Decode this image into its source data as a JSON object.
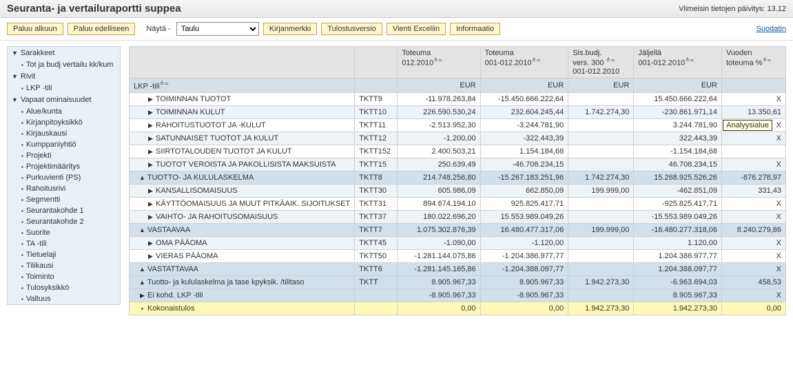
{
  "header": {
    "title": "Seuranta- ja vertailuraportti suppea",
    "updated": "Viimeisin tietojen päivitys: 13.12"
  },
  "toolbar": {
    "back_start": "Paluu alkuun",
    "back_prev": "Paluu edelliseen",
    "nayta_label": "Näytä -",
    "nayta_value": "Taulu",
    "bookmark": "Kirjanmerkki",
    "print": "Tulostusversio",
    "excel": "Vienti Exceliin",
    "info": "Informaatio",
    "filter": "Suodatin"
  },
  "sidebar": {
    "groups": [
      {
        "title": "Sarakkeet",
        "items": [
          "Tot ja budj vertailu kk/kum"
        ]
      },
      {
        "title": "Rivit",
        "items": [
          "LKP -tili"
        ]
      },
      {
        "title": "Vapaat ominaisuudet",
        "items": [
          "Alue/kunta",
          "Kirjanpitoyksikkö",
          "Kirjauskausi",
          "Kumppaniyhtiö",
          "Projekti",
          "Projektimääritys",
          "Purkuvienti (PS)",
          "Rahoitusrivi",
          "Segmentti",
          "Seurantakohde 1",
          "Seurantakohde 2",
          "Suorite",
          "TA -tili",
          "Tietuelaji",
          "Tilikausi",
          "Toiminto",
          "Tulosyksikkö",
          "Valtuus"
        ]
      }
    ]
  },
  "grid": {
    "col0": "",
    "col1": "",
    "col2": {
      "l1": "Toteuma",
      "l2": "012.2010"
    },
    "col3": {
      "l1": "Toteuma",
      "l2": "001-012.2010"
    },
    "col4": {
      "l1": "Sis.budj.",
      "l2": "vers. 300",
      "l3": "001-012.2010"
    },
    "col5": {
      "l1": "Jäljellä",
      "l2": "001-012.2010"
    },
    "col6": {
      "l1": "Vuoden",
      "l2": "toteuma %"
    },
    "h2_lkp": "LKP -tili",
    "h2_eur": "EUR",
    "rows": [
      {
        "cls": "odd",
        "exp": "▶",
        "ind": 1,
        "label": "TOIMINNAN TUOTOT",
        "code": "TKTT9",
        "c2": "-11.978.263,84",
        "c3": "-15.450.666.222,64",
        "c4": "",
        "c5": "15.450.666.222,64",
        "c6": "X"
      },
      {
        "cls": "even",
        "exp": "▶",
        "ind": 1,
        "label": "TOIMINNAN KULUT",
        "code": "TKTT10",
        "c2": "226.590.530,24",
        "c3": "232.604.245,44",
        "c4": "1.742.274,30",
        "c5": "-230.861.971,14",
        "c6": "13.350,61"
      },
      {
        "cls": "odd",
        "exp": "▶",
        "ind": 1,
        "label": "RAHOITUSTUOTOT JA -KULUT",
        "code": "TKTT11",
        "c2": "-2.513.952,30",
        "c3": "-3.244.781,90",
        "c4": "",
        "c5": "3.244.781,90",
        "c6": "X"
      },
      {
        "cls": "even",
        "exp": "▶",
        "ind": 1,
        "label": "SATUNNAISET TUOTOT JA KULUT",
        "code": "TKTT12",
        "c2": "-1.200,00",
        "c3": "-322.443,39",
        "c4": "",
        "c5": "322.443,39",
        "c6": "X"
      },
      {
        "cls": "odd",
        "exp": "▶",
        "ind": 1,
        "label": "SIIRTOTALOUDEN TUOTOT JA KULUT",
        "code": "TKTT152",
        "c2": "2.400.503,21",
        "c3": "1.154.184,68",
        "c4": "",
        "c5": "-1.154.184,68",
        "c6": ""
      },
      {
        "cls": "even",
        "exp": "▶",
        "ind": 1,
        "label": "TUOTOT VEROISTA JA PAKOLLISISTA MAKSUISTA",
        "code": "TKTT15",
        "c2": "250.639,49",
        "c3": "-46.708.234,15",
        "c4": "",
        "c5": "46.708.234,15",
        "c6": "X"
      },
      {
        "cls": "blue",
        "exp": "▲",
        "ind": 0,
        "label": "TUOTTO- JA KULULASKELMA",
        "code": "TKTT8",
        "c2": "214.748.256,80",
        "c3": "-15.267.183.251,96",
        "c4": "1.742.274,30",
        "c5": "15.268.925.526,26",
        "c6": "-876.278,97"
      },
      {
        "cls": "even",
        "exp": "▶",
        "ind": 1,
        "label": "KANSALLISOMAISUUS",
        "code": "TKTT30",
        "c2": "605.986,09",
        "c3": "662.850,09",
        "c4": "199.999,00",
        "c5": "-462.851,09",
        "c6": "331,43"
      },
      {
        "cls": "odd",
        "exp": "▶",
        "ind": 1,
        "label": "KÄYTTÖOMAISUUS JA MUUT PITKÄAIK. SIJOITUKSET",
        "code": "TKTT31",
        "c2": "894.674.194,10",
        "c3": "925.825.417,71",
        "c4": "",
        "c5": "-925.825.417,71",
        "c6": "X"
      },
      {
        "cls": "even",
        "exp": "▶",
        "ind": 1,
        "label": "VAIHTO- JA RAHOITUSOMAISUUS",
        "code": "TKTT37",
        "c2": "180.022.696,20",
        "c3": "15.553.989.049,26",
        "c4": "",
        "c5": "-15.553.989.049,26",
        "c6": "X"
      },
      {
        "cls": "blue",
        "exp": "▲",
        "ind": 0,
        "label": "VASTAAVAA",
        "code": "TKTT7",
        "c2": "1.075.302.876,39",
        "c3": "16.480.477.317,06",
        "c4": "199.999,00",
        "c5": "-16.480.277.318,06",
        "c6": "8.240.279,86"
      },
      {
        "cls": "even",
        "exp": "▶",
        "ind": 1,
        "label": "OMA PÄÄOMA",
        "code": "TKTT45",
        "c2": "-1.090,00",
        "c3": "-1.120,00",
        "c4": "",
        "c5": "1.120,00",
        "c6": "X"
      },
      {
        "cls": "odd",
        "exp": "▶",
        "ind": 1,
        "label": "VIERAS PÄÄOMA",
        "code": "TKTT50",
        "c2": "-1.281.144.075,86",
        "c3": "-1.204.386.977,77",
        "c4": "",
        "c5": "1.204.386.977,77",
        "c6": "X"
      },
      {
        "cls": "blue",
        "exp": "▲",
        "ind": 0,
        "label": "VASTATTAVAA",
        "code": "TKTT6",
        "c2": "-1.281.145.165,86",
        "c3": "-1.204.388.097,77",
        "c4": "",
        "c5": "1.204.388.097,77",
        "c6": "X"
      },
      {
        "cls": "blue",
        "exp": "▲",
        "ind": 0,
        "label": "Tuotto- ja kululaskelma ja tase kpyksik. /tilitaso",
        "code": "TKTT",
        "c2": "8.905.967,33",
        "c3": "8.905.967,33",
        "c4": "1.942.273,30",
        "c5": "-6.963.694,03",
        "c6": "458,53"
      },
      {
        "cls": "blue",
        "exp": "▶",
        "ind": 0,
        "label": "Ei kohd. LKP -tili",
        "code": "",
        "c2": "-8.905.967,33",
        "c3": "-8.905.967,33",
        "c4": "",
        "c5": "8.905.967,33",
        "c6": "X"
      },
      {
        "cls": "highlight",
        "exp": "▪",
        "ind": 0,
        "label": "Kokonaistulos",
        "code": "",
        "c2": "0,00",
        "c3": "0,00",
        "c4": "1.942.273,30",
        "c5": "1.942.273,30",
        "c6": "0,00"
      }
    ]
  },
  "tooltip": "Analyysialue"
}
